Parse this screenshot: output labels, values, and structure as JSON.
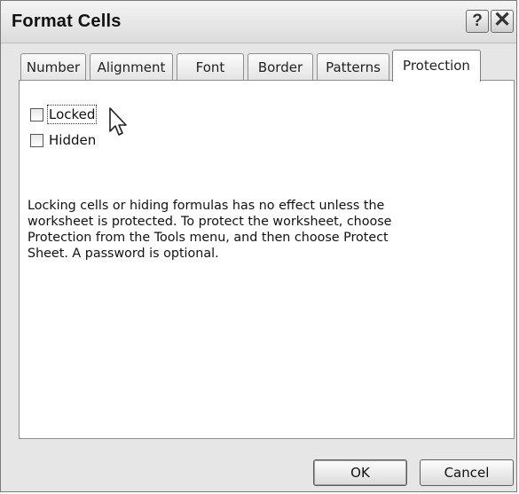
{
  "window": {
    "title": "Format Cells",
    "help_label": "?",
    "close_label": "✕"
  },
  "tabs": [
    {
      "label": "Number"
    },
    {
      "label": "Alignment"
    },
    {
      "label": "Font"
    },
    {
      "label": "Border"
    },
    {
      "label": "Patterns"
    },
    {
      "label": "Protection",
      "selected": true
    }
  ],
  "protection": {
    "locked": {
      "label": "Locked",
      "checked": false
    },
    "hidden": {
      "label": "Hidden",
      "checked": false
    },
    "message": "Locking cells or hiding formulas has no effect unless the worksheet is protected. To protect the worksheet, choose Protection from the Tools menu, and then choose Protect Sheet. A password is optional."
  },
  "buttons": {
    "ok": "OK",
    "cancel": "Cancel"
  },
  "icons": {
    "help": "help-icon",
    "close": "close-icon",
    "cursor": "mouse-pointer-icon"
  }
}
